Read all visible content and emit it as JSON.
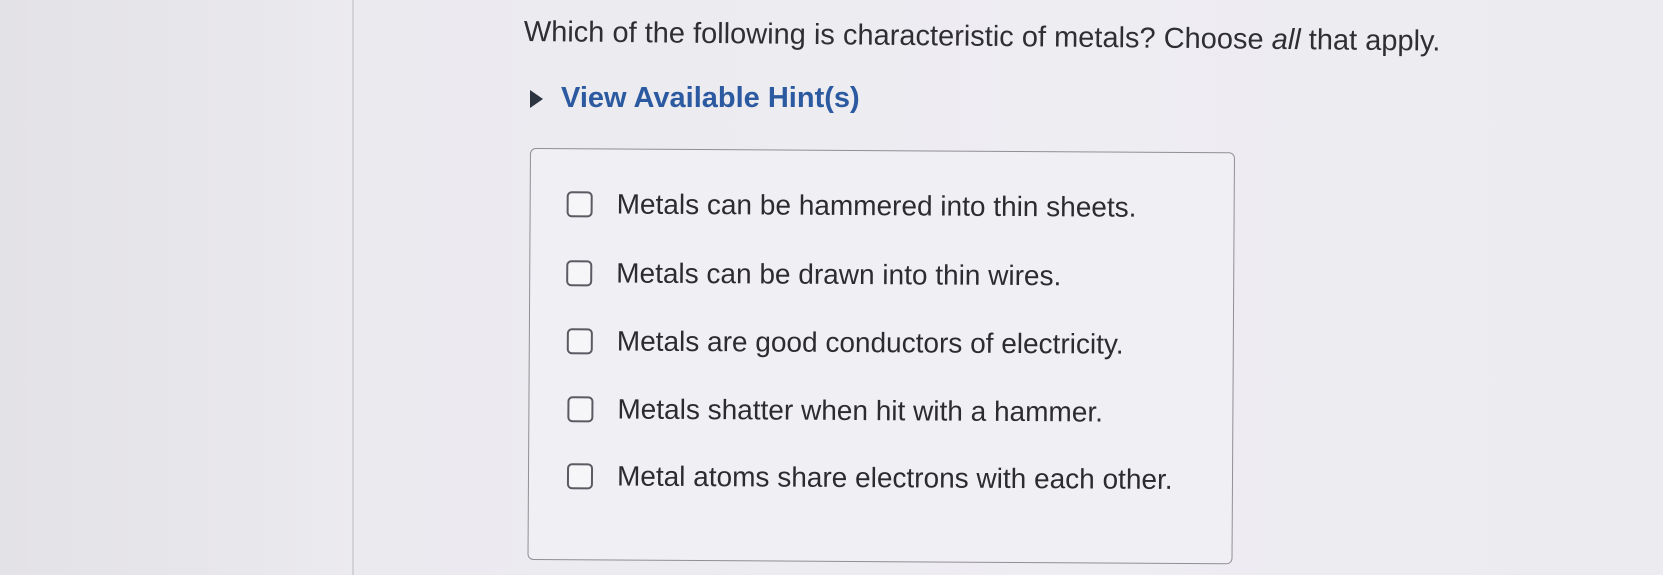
{
  "question": {
    "before": "Which of the following is characteristic of metals? Choose ",
    "emphasis": "all",
    "after": " that apply."
  },
  "hint": {
    "label": "View Available Hint(s)",
    "icon": "triangle-right-icon"
  },
  "options": [
    {
      "label": "Metals can be hammered into thin sheets.",
      "checked": false
    },
    {
      "label": "Metals can be drawn into thin wires.",
      "checked": false
    },
    {
      "label": "Metals are good conductors of electricity.",
      "checked": false
    },
    {
      "label": "Metals shatter when hit with a hammer.",
      "checked": false
    },
    {
      "label": "Metal atoms share electrons with each other.",
      "checked": false
    }
  ],
  "colors": {
    "hint_link": "#2c5aa0",
    "text": "#2c2c30",
    "background": "#ebeaef"
  }
}
